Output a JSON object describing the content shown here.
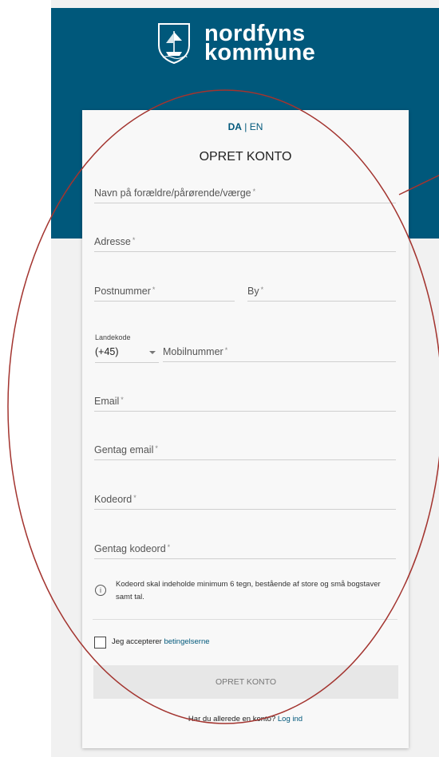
{
  "brand": {
    "line1": "nordfyns",
    "line2": "kommune"
  },
  "lang": {
    "active": "DA",
    "separator": "|",
    "other": "EN"
  },
  "form": {
    "title": "OPRET KONTO",
    "required_mark": "*",
    "fields": {
      "guardian_name": "Navn på forældre/pårørende/værge",
      "address": "Adresse",
      "postcode": "Postnummer",
      "city": "By",
      "country_code_label": "Landekode",
      "country_code_value": "(+45)",
      "mobile": "Mobilnummer",
      "email": "Email",
      "email_repeat": "Gentag email",
      "password": "Kodeord",
      "password_repeat": "Gentag kodeord"
    },
    "info": {
      "icon": "i",
      "text": "Kodeord skal indeholde minimum 6 tegn, bestående af store og små bogstaver samt tal."
    },
    "terms": {
      "prefix": "Jeg accepterer",
      "link": "betingelserne"
    },
    "submit_label": "OPRET KONTO",
    "login": {
      "prompt": "Har du allerede en konto?",
      "link": "Log ind"
    }
  },
  "colors": {
    "brand": "#00587b",
    "annotation": "#a3342f",
    "page_bg": "#f1f1f1"
  }
}
